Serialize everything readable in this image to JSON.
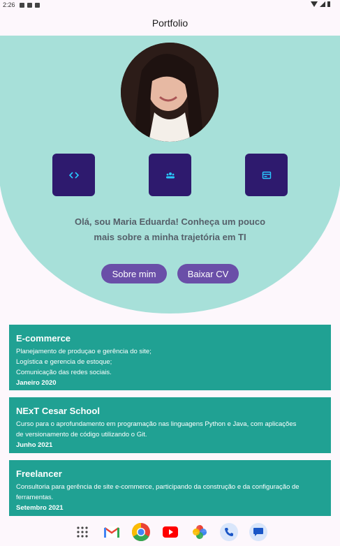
{
  "status": {
    "time": "2:26"
  },
  "appbar": {
    "title": "Portfolio"
  },
  "hero": {
    "intro_line1": "Olá, sou Maria Eduarda! Conheça um pouco",
    "intro_line2": "mais sobre a minha trajetória em TI",
    "buttons": {
      "about": "Sobre mim",
      "cv": "Baixar CV"
    },
    "icon_buttons": [
      "code-icon",
      "team-icon",
      "web-icon"
    ]
  },
  "cards": [
    {
      "title": "E-commerce",
      "lines": [
        "Planejamento de produçao e gerência do site;",
        "Logística e gerencia de estoque;",
        "Comunicação das redes sociais."
      ],
      "date": "Janeiro 2020"
    },
    {
      "title": "NExT Cesar School",
      "lines": [
        "Curso para o aprofundamento em programação nas linguagens Python e Java, com aplicações",
        "de versionamento de código utilizando o Git."
      ],
      "date": "Junho 2021"
    },
    {
      "title": "Freelancer",
      "lines": [
        "Consultoria para gerência de site e-commerce, participando da construção e da configuração de",
        "ferramentas."
      ],
      "date": "Setembro 2021"
    }
  ],
  "dock": [
    "apps-grid-icon",
    "gmail-icon",
    "chrome-icon",
    "youtube-icon",
    "photos-icon",
    "phone-icon",
    "messages-icon"
  ],
  "colors": {
    "hero_bg": "#a7e0d9",
    "card_bg": "#20a193",
    "icon_button_bg": "#2e1a6e",
    "pill_bg": "#6a4fa8"
  }
}
